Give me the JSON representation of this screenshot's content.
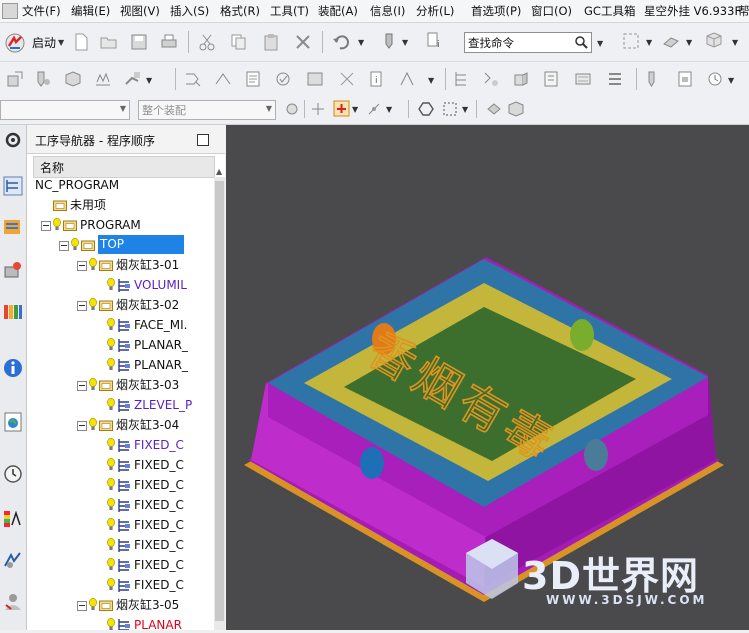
{
  "menu": [
    "文件(F)",
    "编辑(E)",
    "视图(V)",
    "插入(S)",
    "格式(R)",
    "工具(T)",
    "装配(A)",
    "信息(I)",
    "分析(L)",
    "首选项(P)",
    "窗口(O)",
    "GC工具箱",
    "星空外挂 V6.933F",
    "帮"
  ],
  "toolbar": {
    "start_label": "启动",
    "search_placeholder": "查找命令",
    "filter_placeholder": "",
    "assembly_placeholder": "整个装配"
  },
  "navigator": {
    "title": "工序导航器 - 程序顺序",
    "column_header": "名称",
    "rows": [
      {
        "label": "NC_PROGRAM",
        "kind": "root",
        "color": "#111111"
      },
      {
        "label": "未用项",
        "kind": "group",
        "color": "#111111"
      },
      {
        "label": "PROGRAM",
        "kind": "group",
        "color": "#111111"
      },
      {
        "label": "TOP",
        "kind": "group",
        "color": "#ffffff",
        "selected": true
      },
      {
        "label": "烟灰缸3-01",
        "kind": "group",
        "color": "#111111"
      },
      {
        "label": "VOLUMIL",
        "kind": "op",
        "color": "#5a1ec8"
      },
      {
        "label": "烟灰缸3-02",
        "kind": "group",
        "color": "#111111"
      },
      {
        "label": "FACE_MI.",
        "kind": "op",
        "color": "#111111"
      },
      {
        "label": "PLANAR_",
        "kind": "op",
        "color": "#111111"
      },
      {
        "label": "PLANAR_",
        "kind": "op",
        "color": "#111111"
      },
      {
        "label": "烟灰缸3-03",
        "kind": "group",
        "color": "#111111"
      },
      {
        "label": "ZLEVEL_P",
        "kind": "op",
        "color": "#5a1ec8"
      },
      {
        "label": "烟灰缸3-04",
        "kind": "group",
        "color": "#111111"
      },
      {
        "label": "FIXED_C",
        "kind": "op",
        "color": "#5a1ec8"
      },
      {
        "label": "FIXED_C",
        "kind": "op",
        "color": "#111111"
      },
      {
        "label": "FIXED_C",
        "kind": "op",
        "color": "#111111"
      },
      {
        "label": "FIXED_C",
        "kind": "op",
        "color": "#111111"
      },
      {
        "label": "FIXED_C",
        "kind": "op",
        "color": "#111111"
      },
      {
        "label": "FIXED_C",
        "kind": "op",
        "color": "#111111"
      },
      {
        "label": "FIXED_C",
        "kind": "op",
        "color": "#111111"
      },
      {
        "label": "FIXED_C",
        "kind": "op",
        "color": "#111111"
      },
      {
        "label": "烟灰缸3-05",
        "kind": "group",
        "color": "#111111"
      },
      {
        "label": "PLANAR",
        "kind": "op",
        "color": "#e0001a"
      }
    ]
  },
  "model": {
    "engraving": "香烟有毒"
  },
  "watermark": {
    "brand": "3D世界网",
    "url": "WWW.3DSJW.COM"
  },
  "colors": {
    "viewport_bg": "#4a4a4c",
    "selection": "#1e82e6",
    "model_top": "#3c6e2e",
    "model_rim": "#2e74a6",
    "model_wall": "#c4b63a",
    "model_side": "#a41cb4",
    "engraving": "#e0941e"
  }
}
